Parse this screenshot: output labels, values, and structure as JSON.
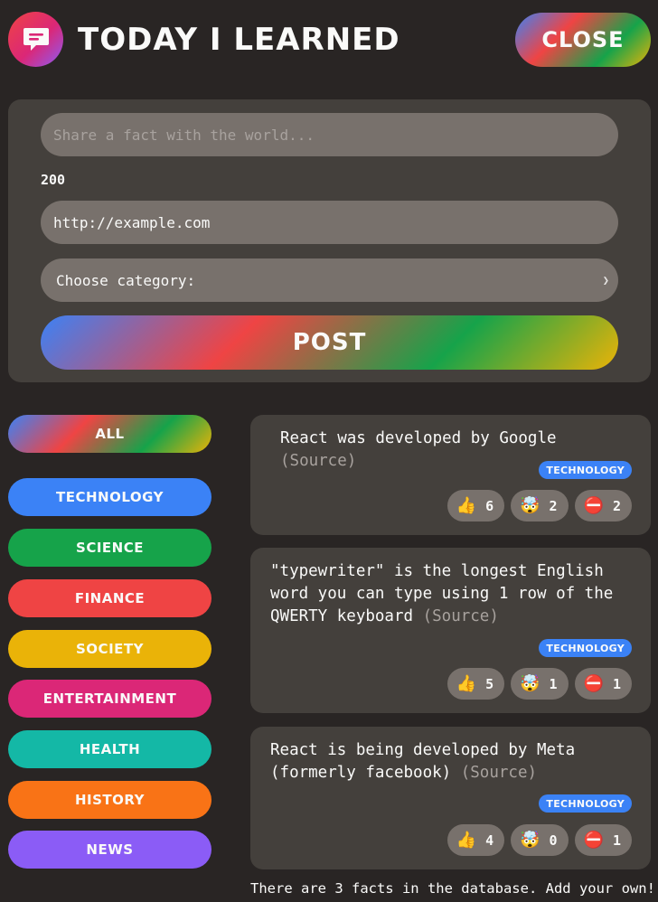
{
  "header": {
    "title": "TODAY I LEARNED",
    "close_label": "CLOSE",
    "logo_icon": "chat-bubble-icon"
  },
  "form": {
    "fact_placeholder": "Share a fact with the world...",
    "char_count": "200",
    "source_value": "http://example.com",
    "category_selected": "Choose category:",
    "post_label": "POST"
  },
  "categories": [
    {
      "label": "ALL",
      "color": "gradient"
    },
    {
      "label": "TECHNOLOGY",
      "color": "#3b82f6"
    },
    {
      "label": "SCIENCE",
      "color": "#16a34a"
    },
    {
      "label": "FINANCE",
      "color": "#ef4444"
    },
    {
      "label": "SOCIETY",
      "color": "#eab308"
    },
    {
      "label": "ENTERTAINMENT",
      "color": "#db2777"
    },
    {
      "label": "HEALTH",
      "color": "#14b8a6"
    },
    {
      "label": "HISTORY",
      "color": "#f97316"
    },
    {
      "label": "NEWS",
      "color": "#8b5cf6"
    }
  ],
  "facts": [
    {
      "text": "React was developed by Google",
      "source_label": "(Source)",
      "category": "TECHNOLOGY",
      "votes": {
        "interesting": "6",
        "mindblowing": "2",
        "false": "2"
      }
    },
    {
      "text": "\"typewriter\" is the longest English word you can type using 1 row of the QWERTY keyboard",
      "source_label": "(Source)",
      "category": "TECHNOLOGY",
      "votes": {
        "interesting": "5",
        "mindblowing": "1",
        "false": "1"
      }
    },
    {
      "text": "React is being developed by Meta (formerly facebook)",
      "source_label": "(Source)",
      "category": "TECHNOLOGY",
      "votes": {
        "interesting": "4",
        "mindblowing": "0",
        "false": "1"
      }
    }
  ],
  "vote_icons": {
    "interesting": "👍",
    "mindblowing": "🤯",
    "false": "⛔️"
  },
  "footer_message": "There are 3 facts in the database. Add your own!"
}
